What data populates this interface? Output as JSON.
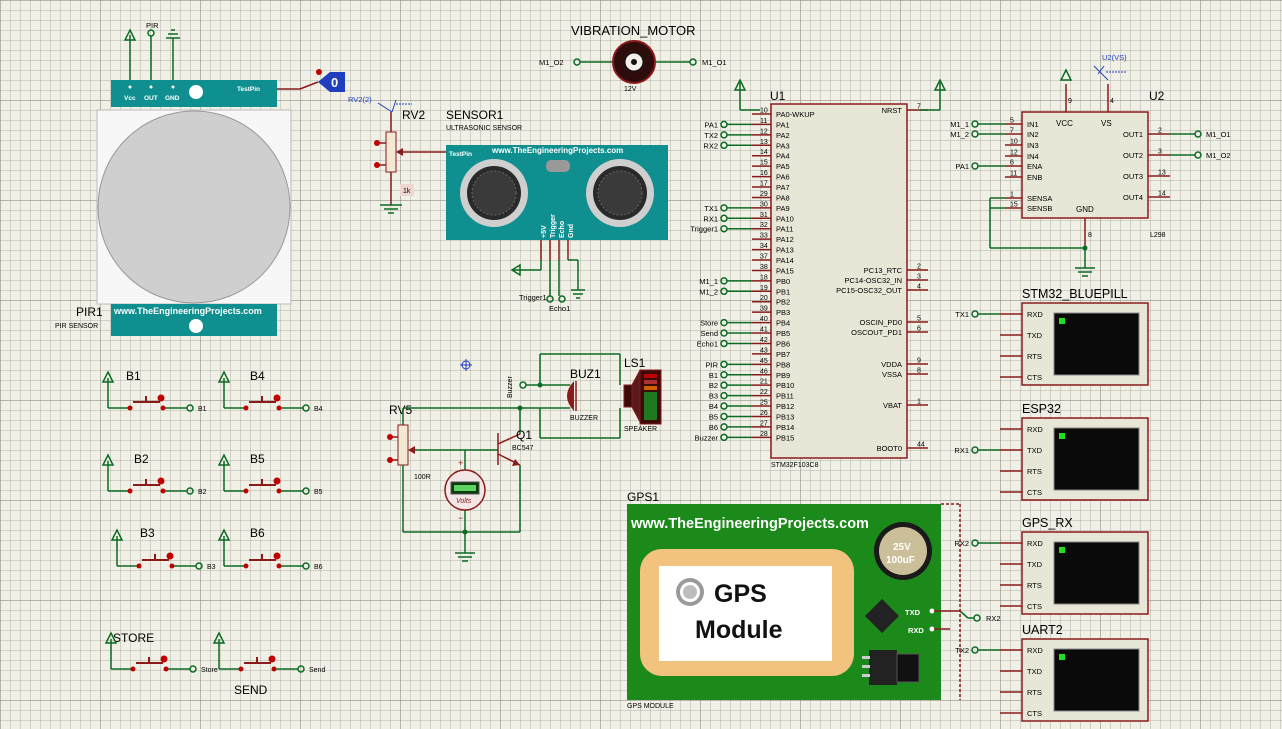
{
  "components": {
    "pir": {
      "ref": "PIR1",
      "value": "PIR SENSOR",
      "top_label": "PIR",
      "pins": [
        "Vcc",
        "OUT",
        "GND"
      ],
      "testpin": "TestPin",
      "site": "www.TheEngineeringProjects.com"
    },
    "logic_probe": {
      "value": "0"
    },
    "rv2": {
      "ref": "RV2",
      "tag": "RV2(2)",
      "value": "1k"
    },
    "sensor1": {
      "ref": "SENSOR1",
      "value": "ULTRASONIC SENSOR",
      "testpin": "TestPin",
      "site": "www.TheEngineeringProjects.com",
      "pins": [
        "+5V",
        "Trigger",
        "Echo",
        "Gnd"
      ],
      "net_trigger": "Trigger1",
      "net_echo": "Echo1"
    },
    "motor": {
      "ref": "VIBRATION_MOTOR",
      "value": "12V",
      "net_left": "M1_O2",
      "net_right": "M1_O1"
    },
    "u1": {
      "ref": "U1",
      "part": "STM32F103C8",
      "left_pins": [
        {
          "n": "10",
          "name": "PA0-WKUP",
          "net": ""
        },
        {
          "n": "11",
          "name": "PA1",
          "net": "PA1"
        },
        {
          "n": "12",
          "name": "PA2",
          "net": "TX2"
        },
        {
          "n": "13",
          "name": "PA3",
          "net": "RX2"
        },
        {
          "n": "14",
          "name": "PA4",
          "net": ""
        },
        {
          "n": "15",
          "name": "PA5",
          "net": ""
        },
        {
          "n": "16",
          "name": "PA6",
          "net": ""
        },
        {
          "n": "17",
          "name": "PA7",
          "net": ""
        },
        {
          "n": "29",
          "name": "PA8",
          "net": ""
        },
        {
          "n": "30",
          "name": "PA9",
          "net": "TX1"
        },
        {
          "n": "31",
          "name": "PA10",
          "net": "RX1"
        },
        {
          "n": "32",
          "name": "PA11",
          "net": "Trigger1"
        },
        {
          "n": "33",
          "name": "PA12",
          "net": ""
        },
        {
          "n": "34",
          "name": "PA13",
          "net": ""
        },
        {
          "n": "37",
          "name": "PA14",
          "net": ""
        },
        {
          "n": "38",
          "name": "PA15",
          "net": ""
        },
        {
          "n": "18",
          "name": "PB0",
          "net": "M1_1"
        },
        {
          "n": "19",
          "name": "PB1",
          "net": "M1_2"
        },
        {
          "n": "20",
          "name": "PB2",
          "net": ""
        },
        {
          "n": "39",
          "name": "PB3",
          "net": ""
        },
        {
          "n": "40",
          "name": "PB4",
          "net": "Store"
        },
        {
          "n": "41",
          "name": "PB5",
          "net": "Send"
        },
        {
          "n": "42",
          "name": "PB6",
          "net": "Echo1"
        },
        {
          "n": "43",
          "name": "PB7",
          "net": ""
        },
        {
          "n": "45",
          "name": "PB8",
          "net": "PIR"
        },
        {
          "n": "46",
          "name": "PB9",
          "net": "B1"
        },
        {
          "n": "21",
          "name": "PB10",
          "net": "B2"
        },
        {
          "n": "22",
          "name": "PB11",
          "net": "B3"
        },
        {
          "n": "25",
          "name": "PB12",
          "net": "B4"
        },
        {
          "n": "26",
          "name": "PB13",
          "net": "B5"
        },
        {
          "n": "27",
          "name": "PB14",
          "net": "B6"
        },
        {
          "n": "28",
          "name": "PB15",
          "net": "Buzzer"
        }
      ],
      "right_pins": [
        {
          "n": "7",
          "name": "NRST"
        },
        {
          "n": "2",
          "name": "PC13_RTC"
        },
        {
          "n": "3",
          "name": "PC14-OSC32_IN"
        },
        {
          "n": "4",
          "name": "PC15-OSC32_OUT"
        },
        {
          "n": "5",
          "name": "OSCIN_PD0"
        },
        {
          "n": "6",
          "name": "OSCOUT_PD1"
        },
        {
          "n": "9",
          "name": "VDDA"
        },
        {
          "n": "8",
          "name": "VSSA"
        },
        {
          "n": "1",
          "name": "VBAT"
        },
        {
          "n": "44",
          "name": "BOOT0"
        }
      ]
    },
    "u2": {
      "ref": "U2",
      "part": "L298",
      "vs_tag": "U2(VS)",
      "left_pins": [
        {
          "n": "5",
          "name": "IN1",
          "net": "M1_1"
        },
        {
          "n": "7",
          "name": "IN2",
          "net": "M1_2"
        },
        {
          "n": "10",
          "name": "IN3",
          "net": ""
        },
        {
          "n": "12",
          "name": "IN4",
          "net": ""
        },
        {
          "n": "6",
          "name": "ENA",
          "net": "PA1"
        },
        {
          "n": "11",
          "name": "ENB",
          "net": ""
        },
        {
          "n": "1",
          "name": "SENSA",
          "net": ""
        },
        {
          "n": "15",
          "name": "SENSB",
          "net": ""
        }
      ],
      "right_pins": [
        {
          "n": "2",
          "name": "OUT1",
          "net": "M1_O1"
        },
        {
          "n": "3",
          "name": "OUT2",
          "net": "M1_O2"
        },
        {
          "n": "13",
          "name": "OUT3",
          "net": ""
        },
        {
          "n": "14",
          "name": "OUT4",
          "net": ""
        }
      ],
      "top_pins": [
        {
          "n": "9",
          "name": "VCC"
        },
        {
          "n": "4",
          "name": "VS"
        }
      ],
      "bottom_pin": {
        "n": "8",
        "name": "GND"
      }
    },
    "terminals": [
      {
        "title": "STM32_BLUEPILL",
        "net": "TX1",
        "net_row": 0
      },
      {
        "title": "ESP32",
        "net": "RX1",
        "net_row": 1
      },
      {
        "title": "GPS_RX",
        "net": "RX2",
        "net_row": 0
      },
      {
        "title": "UART2",
        "net": "TX2",
        "net_row": 0
      }
    ],
    "terminal_pins": [
      "RXD",
      "TXD",
      "RTS",
      "CTS"
    ],
    "buttons": [
      {
        "ref": "B1",
        "net": "B1"
      },
      {
        "ref": "B4",
        "net": "B4"
      },
      {
        "ref": "B2",
        "net": "B2"
      },
      {
        "ref": "B5",
        "net": "B5"
      },
      {
        "ref": "B3",
        "net": "B3"
      },
      {
        "ref": "B6",
        "net": "B6"
      },
      {
        "ref": "STORE",
        "net": "Store"
      },
      {
        "ref": "SEND",
        "net": "Send"
      }
    ],
    "rv5": {
      "ref": "RV5",
      "value": "100R"
    },
    "q1": {
      "ref": "Q1",
      "value": "BC547"
    },
    "voltmeter": {
      "unit": "Volts"
    },
    "buzzer": {
      "ref": "BUZ1",
      "value": "BUZZER",
      "net": "Buzzer"
    },
    "speaker": {
      "ref": "LS1",
      "value": "SPEAKER"
    },
    "gps": {
      "ref": "GPS1",
      "value": "GPS MODULE",
      "site": "www.TheEngineeringProjects.com",
      "title1": "GPS",
      "title2": "Module",
      "cap1": "25V",
      "cap2": "100uF",
      "pin_tx": "TXD",
      "pin_rx": "RXD",
      "net_tx": "RX2"
    }
  },
  "colors": {
    "wire": "#0b6b22",
    "part": "#8b1a1a",
    "teal": "#0f8f8f",
    "gps_green": "#1b8a1b",
    "chip_fill": "#e8e6d6"
  }
}
